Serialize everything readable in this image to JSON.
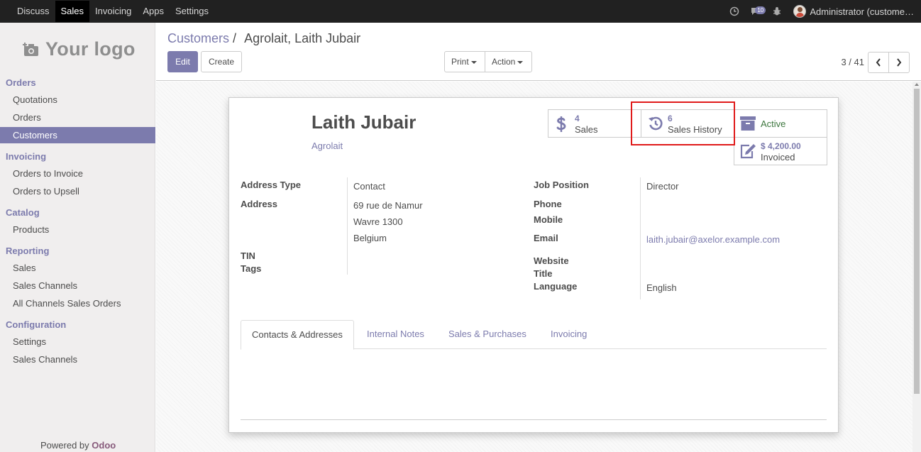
{
  "topbar": {
    "menu": [
      "Discuss",
      "Sales",
      "Invoicing",
      "Apps",
      "Settings"
    ],
    "active_menu": "Sales",
    "messages_badge": "10",
    "user_name": "Administrator (custome…"
  },
  "sidebar": {
    "logo_text": "Your logo",
    "sections": {
      "orders": "Orders",
      "invoicing": "Invoicing",
      "catalog": "Catalog",
      "reporting": "Reporting",
      "configuration": "Configuration"
    },
    "items": {
      "quotations": "Quotations",
      "orders": "Orders",
      "customers": "Customers",
      "orders_to_invoice": "Orders to Invoice",
      "orders_to_upsell": "Orders to Upsell",
      "products": "Products",
      "rep_sales": "Sales",
      "rep_sales_channels": "Sales Channels",
      "rep_all_channels": "All Channels Sales Orders",
      "conf_settings": "Settings",
      "conf_sales_channels": "Sales Channels"
    },
    "powered_by": "Powered by",
    "powered_brand": "Odoo"
  },
  "control_panel": {
    "breadcrumb_parent": "Customers",
    "breadcrumb_sep": "/",
    "breadcrumb_current": "Agrolait, Laith Jubair",
    "edit_label": "Edit",
    "create_label": "Create",
    "print_label": "Print",
    "action_label": "Action",
    "pager": "3 / 41"
  },
  "record": {
    "name": "Laith Jubair",
    "company": "Agrolait",
    "smart_buttons": {
      "sales_count": "4",
      "sales_label": "Sales",
      "history_count": "6",
      "history_label": "Sales History",
      "active_label": "Active",
      "invoiced_amount": "$ 4,200.00",
      "invoiced_label": "Invoiced"
    },
    "fields": {
      "address_type_label": "Address Type",
      "address_type": "Contact",
      "address_label": "Address",
      "street": "69 rue de Namur",
      "city_zip": "Wavre 1300",
      "country": "Belgium",
      "tin_label": "TIN",
      "tags_label": "Tags",
      "job_position_label": "Job Position",
      "job_position": "Director",
      "phone_label": "Phone",
      "mobile_label": "Mobile",
      "email_label": "Email",
      "email": "laith.jubair@axelor.example.com",
      "website_label": "Website",
      "title_label": "Title",
      "language_label": "Language",
      "language": "English"
    },
    "tabs": [
      "Contacts & Addresses",
      "Internal Notes",
      "Sales & Purchases",
      "Invoicing"
    ]
  },
  "colors": {
    "accent": "#7c7bad",
    "highlight": "#e01a1a",
    "active_green": "#3c763d"
  }
}
